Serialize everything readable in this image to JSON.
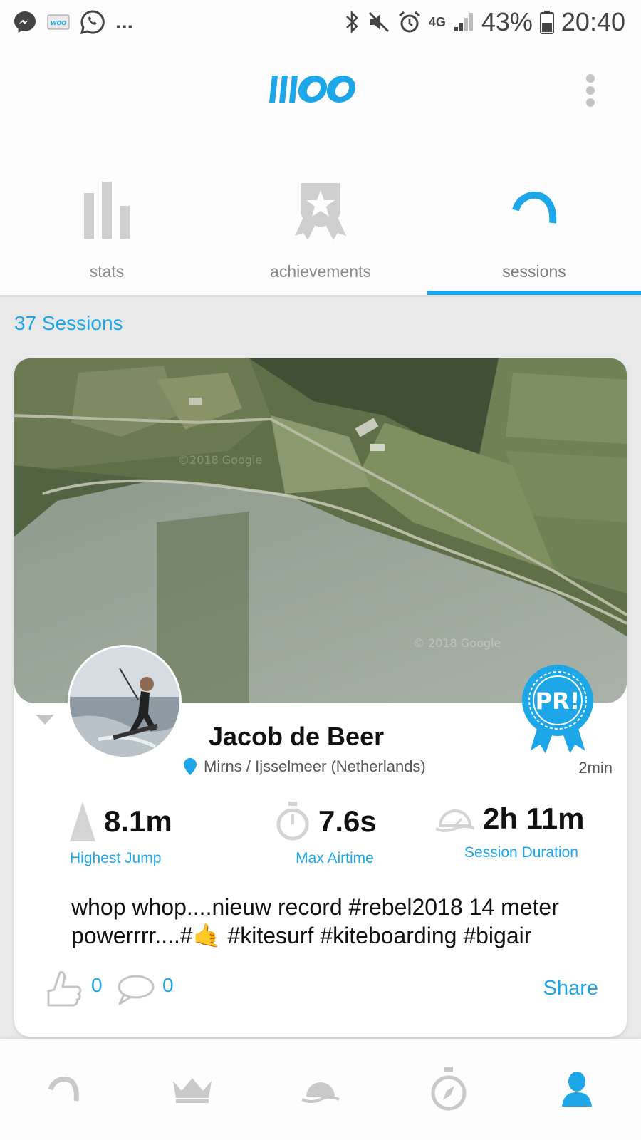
{
  "status_bar": {
    "overflow": "...",
    "network": "4G",
    "battery": "43%",
    "time": "20:40",
    "icons": [
      "messenger-icon",
      "mail-icon",
      "whatsapp-icon",
      "bluetooth-icon",
      "mute-icon",
      "alarm-icon",
      "signal-icon",
      "battery-icon"
    ]
  },
  "header": {
    "logo": "WOO",
    "menu_icon": "more-vert-icon"
  },
  "tabs": [
    {
      "label": "stats",
      "icon": "bar-chart-icon",
      "active": false
    },
    {
      "label": "achievements",
      "icon": "badge-star-icon",
      "active": false
    },
    {
      "label": "sessions",
      "icon": "sessions-arc-icon",
      "active": true
    }
  ],
  "sessions": {
    "count_label": "37 Sessions"
  },
  "session_card": {
    "user_name": "Jacob de Beer",
    "location": "Mirns / Ijsselmeer (Netherlands)",
    "time_ago": "2min",
    "badge": "PR!",
    "map_watermarks": [
      "©2018 Google",
      "© 2018 Google"
    ],
    "stats": [
      {
        "value": "8.1m",
        "label": "Highest Jump",
        "icon": "jump-icon"
      },
      {
        "value": "7.6s",
        "label": "Max Airtime",
        "icon": "stopwatch-icon"
      },
      {
        "value": "2h 11m",
        "label": "Session Duration",
        "icon": "duration-icon"
      }
    ],
    "caption_line1": "whop whop....nieuw record #rebel2018 14 meter",
    "caption_line2_pre": "powerrrr....#",
    "caption_emoji": "🤙",
    "caption_line2_post": " #kitesurf #kiteboarding #bigair",
    "likes": "0",
    "comments": "0",
    "share_label": "Share"
  },
  "bottom_nav": [
    {
      "icon": "sessions-arc-icon",
      "active": false
    },
    {
      "icon": "crown-icon",
      "active": false
    },
    {
      "icon": "spot-icon",
      "active": false
    },
    {
      "icon": "compass-icon",
      "active": false
    },
    {
      "icon": "profile-icon",
      "active": true
    }
  ],
  "colors": {
    "accent": "#1ea7e8",
    "inactive_icon": "#c9c9c9",
    "background": "#e9e9e9"
  }
}
